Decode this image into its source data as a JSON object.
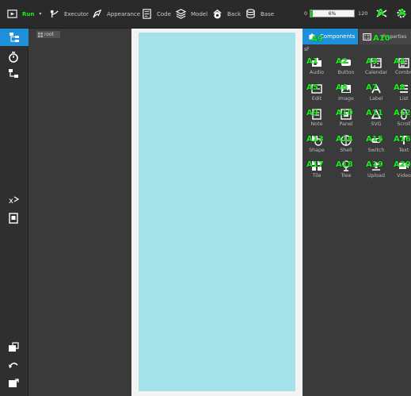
{
  "toolbar": {
    "items": [
      {
        "label": "Run",
        "icon": "play-window-icon"
      },
      {
        "label": "Executor",
        "icon": "executor-icon"
      },
      {
        "label": "Appearance",
        "icon": "appearance-icon"
      },
      {
        "label": "Code",
        "icon": "code-icon"
      },
      {
        "label": "Model",
        "icon": "model-icon"
      },
      {
        "label": "Back",
        "icon": "back-icon"
      },
      {
        "label": "Base",
        "icon": "database-icon"
      }
    ],
    "zoom": {
      "min": "0",
      "value": "6%",
      "max": "120",
      "fraction": 0.06
    }
  },
  "tree": {
    "root_label": "root"
  },
  "right_panel": {
    "tabs": [
      {
        "label": "Components"
      },
      {
        "label": "Properties"
      }
    ],
    "section_label": "sF",
    "components": [
      {
        "label": "Audio"
      },
      {
        "label": "Button"
      },
      {
        "label": "Calendar"
      },
      {
        "label": "Combo"
      },
      {
        "label": "Edit"
      },
      {
        "label": "Image"
      },
      {
        "label": "Label"
      },
      {
        "label": "List"
      },
      {
        "label": "Note"
      },
      {
        "label": "Panel"
      },
      {
        "label": "SVG"
      },
      {
        "label": "Scroll"
      },
      {
        "label": "Shape"
      },
      {
        "label": "Shell"
      },
      {
        "label": "Switch"
      },
      {
        "label": "Text"
      },
      {
        "label": "Tile"
      },
      {
        "label": "Tree"
      },
      {
        "label": "Upload"
      },
      {
        "label": "Video"
      }
    ]
  },
  "overlay_labels": {
    "tab_a9": "A9",
    "tab_a10": "A10",
    "components": [
      "A1",
      "A2",
      "A3",
      "A4",
      "A5",
      "A6",
      "A7",
      "A8",
      "A9",
      "A10",
      "A11",
      "A12",
      "A13",
      "A14",
      "A15",
      "A16",
      "A17",
      "A18",
      "A19",
      "A20"
    ]
  },
  "colors": {
    "accent": "#1e90d9",
    "device": "#a5e1e8",
    "overlay": "#19f01c"
  }
}
